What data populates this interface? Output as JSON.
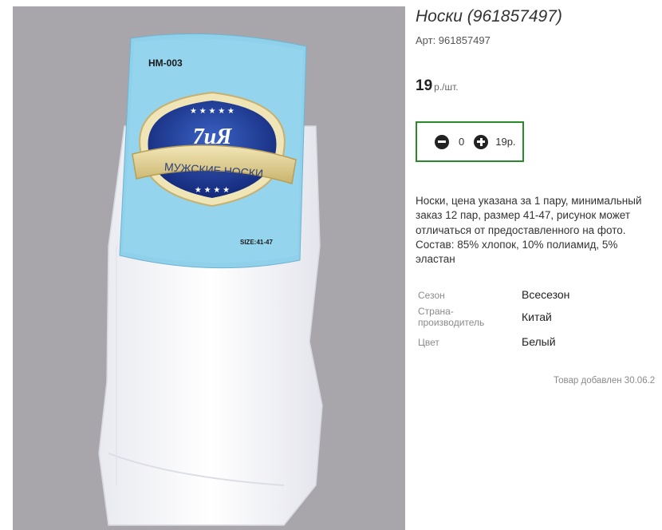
{
  "product": {
    "title": "Носки (961857497)",
    "sku_label": "Арт: 961857497",
    "price_value": "19",
    "price_unit": "р./шт.",
    "quantity": "0",
    "cart_sum": "19р.",
    "description": "Носки, цена указана за 1 пару, минимальный заказ 12 пар, размер 41-47, рисунок может отличаться от предоставленного на фото. Состав: 85% хлопок, 10% полиамид, 5% эластан",
    "added_text": "Товар добавлен 30.06.2"
  },
  "properties": [
    {
      "name": "Сезон",
      "value": "Всесезон"
    },
    {
      "name": "Страна-производитель",
      "value": "Китай"
    },
    {
      "name": "Цвет",
      "value": "Белый"
    }
  ],
  "photo": {
    "model_code": "HM-003",
    "brand": "7иЯ",
    "banner_text": "МУЖСКИЕ НОСКИ",
    "size_text": "SIZE:41-47"
  },
  "colors": {
    "accent_border": "#2a8a2a",
    "photo_background": "#a8a6ab",
    "label_blue": "#8fd0ea",
    "badge_navy": "#1a3a8a"
  }
}
